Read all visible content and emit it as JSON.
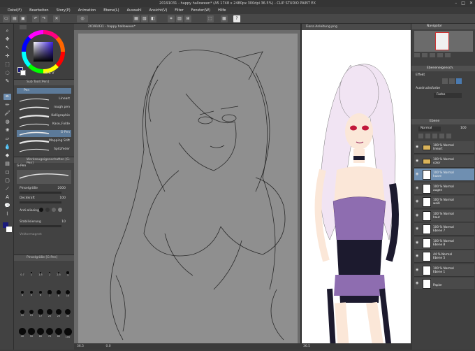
{
  "window": {
    "title": "20191031 - happy halloween* (A5 1748 x 2480px 300dpi 36.5%) - CLIP STUDIO PAINT EX",
    "controls": [
      "–",
      "□",
      "✕"
    ]
  },
  "menu": [
    "Datei(F)",
    "Bearbeiten",
    "Story(P)",
    "Animation",
    "Ebene(L)",
    "Auswahl",
    "Ansicht(V)",
    "Filter",
    "Fenster(W)",
    "Hilfe"
  ],
  "canvas_tab": "20191031 - happy halloween*",
  "reference_tab": "Fiona Anleitung.png",
  "subtool": {
    "title": "Sub Tool [Pen]",
    "group": "Pen",
    "brushes": [
      {
        "name": "Lineart",
        "selected": false
      },
      {
        "name": "rough pen",
        "selected": false
      },
      {
        "name": "Kalligraphie",
        "selected": false
      },
      {
        "name": "Kase_Folde",
        "selected": false
      },
      {
        "name": "G-Pen",
        "selected": true
      },
      {
        "name": "Mapping Stift",
        "selected": false
      },
      {
        "name": "Spitzfeder",
        "selected": false
      }
    ]
  },
  "toolprop": {
    "title": "Werkzeugeigenschaften [G-Pen]",
    "tool": "G-Pen",
    "size_label": "Pinselgröße",
    "size_value": "2000",
    "pressure_label": "Deckkraft",
    "pressure_value": "100",
    "aa_label": "Anti-aliasing",
    "stab_label": "Stabilisierung",
    "stab_value": "10",
    "vector_label": "Vektormagnet"
  },
  "brushsize": {
    "title": "Pinselgröße [G-Pen]",
    "sizes": [
      "0.7",
      "1",
      "1.5",
      "2",
      "2.5",
      "3",
      "4",
      "5",
      "6",
      "7",
      "8",
      "10",
      "12",
      "15",
      "17",
      "20",
      "25",
      "30",
      "40",
      "50",
      "60",
      "70",
      "80",
      "100"
    ]
  },
  "statusbar": {
    "zoom_left": "36.5",
    "zoom_right": "36.5",
    "coords": "0.0"
  },
  "navigator": {
    "title": "Navigator"
  },
  "layerprop": {
    "title": "Ebeneneigensch.",
    "effect_label": "Effekt",
    "color_label": "Ausdrucksfarbe",
    "color_value": "Farbe"
  },
  "layers": {
    "title": "Ebene",
    "blend": "Normal",
    "opacity": "100",
    "items": [
      {
        "line1": "100 % Normal",
        "line2": "lineart",
        "kind": "folder",
        "selected": false
      },
      {
        "line1": "100 % Normal",
        "line2": "color",
        "kind": "folder",
        "selected": false
      },
      {
        "line1": "100 % Normal",
        "line2": "haare",
        "kind": "layer",
        "selected": true
      },
      {
        "line1": "100 % Normal",
        "line2": "augen",
        "kind": "layer",
        "selected": false
      },
      {
        "line1": "100 % Normal",
        "line2": "weiß",
        "kind": "layer",
        "selected": false
      },
      {
        "line1": "100 % Normal",
        "line2": "haut",
        "kind": "layer",
        "selected": false
      },
      {
        "line1": "100 % Normal",
        "line2": "Ebene 7",
        "kind": "layer",
        "selected": false
      },
      {
        "line1": "100 % Normal",
        "line2": "Ebene 8",
        "kind": "layer",
        "selected": false
      },
      {
        "line1": "44 % Normal",
        "line2": "Ebene 5",
        "kind": "layer",
        "selected": false
      },
      {
        "line1": "100 % Normal",
        "line2": "Ebene 1",
        "kind": "layer",
        "selected": false
      },
      {
        "line1": "",
        "line2": "Papier",
        "kind": "paper",
        "selected": false
      }
    ]
  },
  "colors": {
    "accent": "#6f8fb1",
    "primary_color": "#2a2a8a",
    "hair": "#f2e6f2",
    "outfit": "#8e6db0",
    "dark": "#1c1a2e"
  }
}
